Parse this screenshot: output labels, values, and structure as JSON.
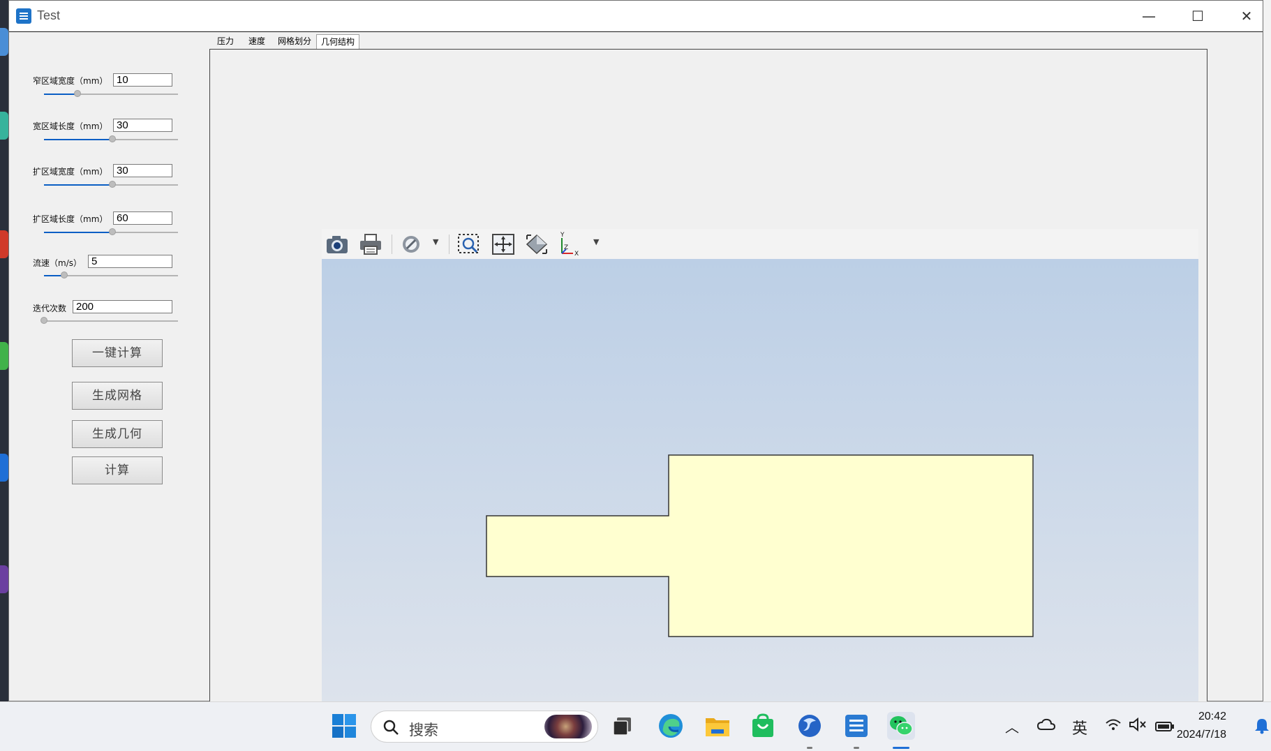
{
  "window": {
    "title": "Test",
    "minimize_glyph": "—",
    "maximize_glyph": "☐",
    "close_glyph": "✕"
  },
  "params": [
    {
      "label": "窄区域宽度（mm）",
      "value": "10",
      "slider_fraction": 0.25
    },
    {
      "label": "宽区域长度（mm）",
      "value": "30",
      "slider_fraction": 0.51
    },
    {
      "label": "扩区域宽度（mm）",
      "value": "30",
      "slider_fraction": 0.51
    },
    {
      "label": "扩区域长度（mm）",
      "value": "60",
      "slider_fraction": 0.51
    },
    {
      "label": "流速（m/s）",
      "value": "5",
      "slider_fraction": 0.15
    },
    {
      "label": "迭代次数",
      "value": "200",
      "slider_fraction": 0.0
    }
  ],
  "buttons": {
    "one_click": "一键计算",
    "gen_mesh": "生成网格",
    "gen_geom": "生成几何",
    "compute": "计算"
  },
  "tabs": [
    "压力",
    "速度",
    "网格划分",
    "几何结构"
  ],
  "active_tab": 3,
  "viewer": {
    "toolbar_icons": [
      "camera-icon",
      "print-icon",
      "no-entry-icon",
      "zoom-box-icon",
      "pan-icon",
      "fit-view-icon",
      "axes-icon"
    ],
    "axes_labels": {
      "y": "Y",
      "z": "Z",
      "x": "X"
    },
    "geometry_fill": "#ffffd0",
    "background_top": "#bccfe6",
    "background_bottom": "#dde3ec"
  },
  "taskbar": {
    "search_placeholder": "搜索",
    "ime": "英",
    "time": "20:42",
    "date": "2024/7/18"
  }
}
